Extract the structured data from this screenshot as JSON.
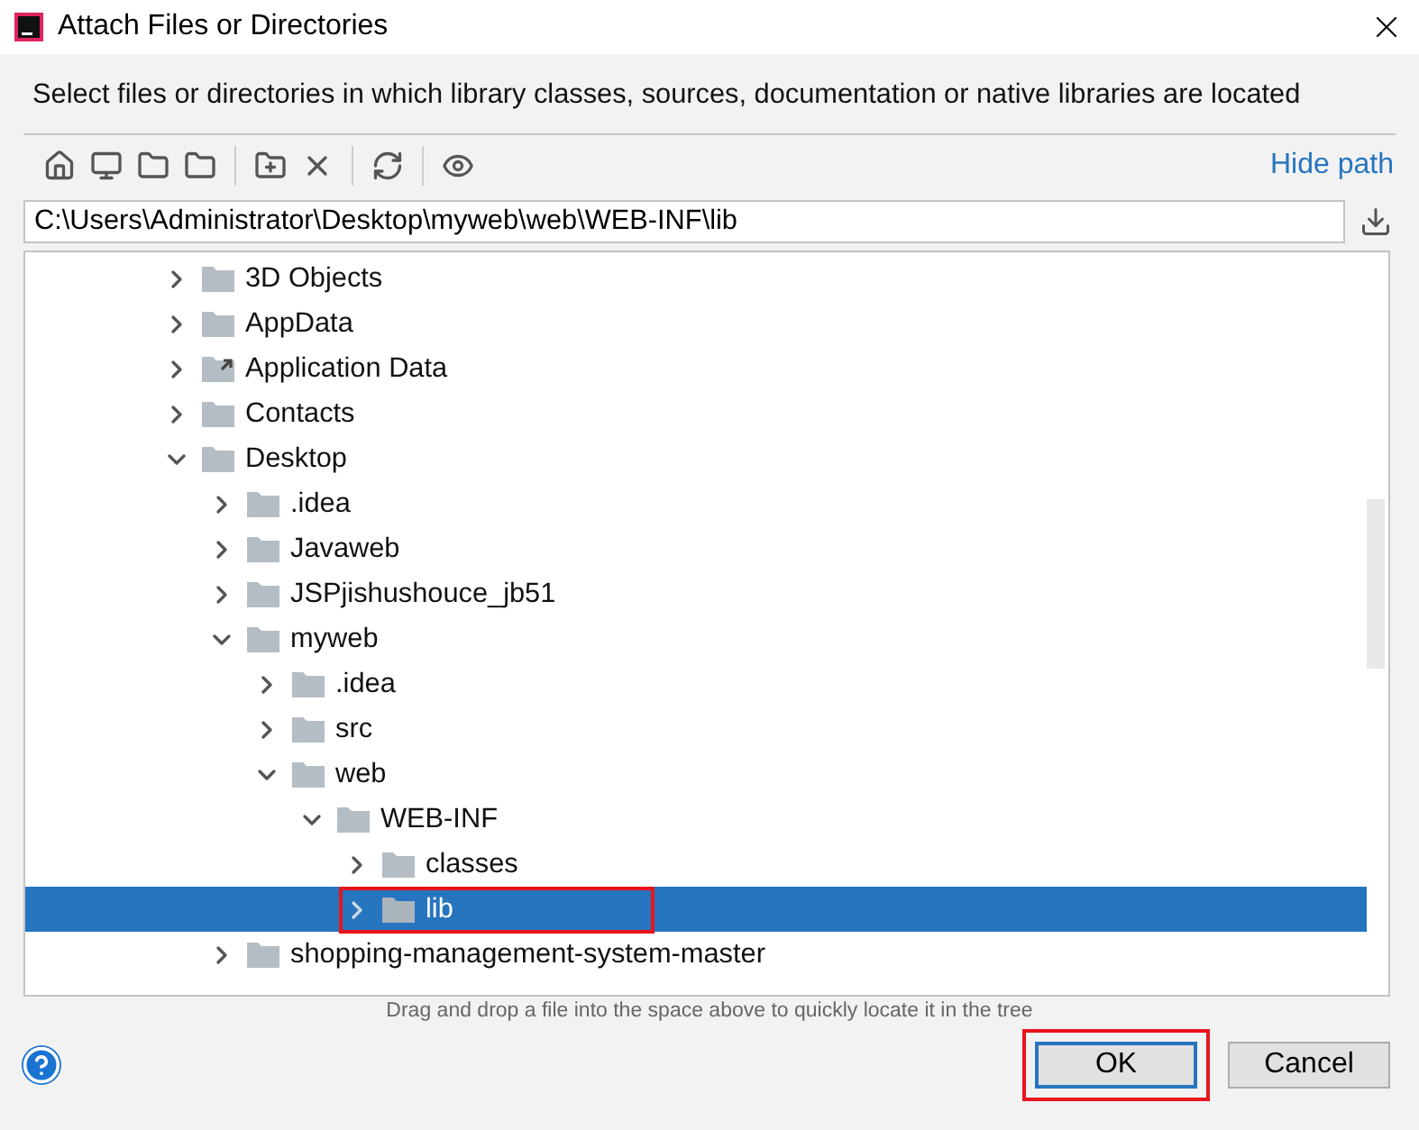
{
  "window": {
    "title": "Attach Files or Directories"
  },
  "description": "Select files or directories in which library classes, sources, documentation or native libraries are located",
  "toolbar": {
    "hide_path_link": "Hide path"
  },
  "path_field": {
    "value": "C:\\Users\\Administrator\\Desktop\\myweb\\web\\WEB-INF\\lib"
  },
  "tree": [
    {
      "label": "3D Objects",
      "kind": "folder",
      "expanded": false,
      "selected": false,
      "highlighted": false
    },
    {
      "label": "AppData",
      "kind": "folder",
      "expanded": false,
      "selected": false,
      "highlighted": false
    },
    {
      "label": "Application Data",
      "kind": "link",
      "expanded": false,
      "selected": false,
      "highlighted": false
    },
    {
      "label": "Contacts",
      "kind": "folder",
      "expanded": false,
      "selected": false,
      "highlighted": false
    },
    {
      "label": "Desktop",
      "kind": "folder",
      "expanded": true,
      "selected": false,
      "highlighted": false,
      "children": [
        {
          "label": ".idea",
          "kind": "folder",
          "expanded": false,
          "selected": false,
          "highlighted": false
        },
        {
          "label": "Javaweb",
          "kind": "folder",
          "expanded": false,
          "selected": false,
          "highlighted": false
        },
        {
          "label": "JSPjishushouce_jb51",
          "kind": "folder",
          "expanded": false,
          "selected": false,
          "highlighted": false
        },
        {
          "label": "myweb",
          "kind": "folder",
          "expanded": true,
          "selected": false,
          "highlighted": false,
          "children": [
            {
              "label": ".idea",
              "kind": "folder",
              "expanded": false,
              "selected": false,
              "highlighted": false
            },
            {
              "label": "src",
              "kind": "folder",
              "expanded": false,
              "selected": false,
              "highlighted": false
            },
            {
              "label": "web",
              "kind": "folder",
              "expanded": true,
              "selected": false,
              "highlighted": false,
              "children": [
                {
                  "label": "WEB-INF",
                  "kind": "folder",
                  "expanded": true,
                  "selected": false,
                  "highlighted": false,
                  "children": [
                    {
                      "label": "classes",
                      "kind": "folder",
                      "expanded": false,
                      "selected": false,
                      "highlighted": false
                    },
                    {
                      "label": "lib",
                      "kind": "folder",
                      "expanded": false,
                      "selected": true,
                      "highlighted": true
                    }
                  ]
                }
              ]
            }
          ]
        },
        {
          "label": "shopping-management-system-master",
          "kind": "folder",
          "expanded": false,
          "selected": false,
          "highlighted": false
        }
      ]
    }
  ],
  "hint": "Drag and drop a file into the space above to quickly locate it in the tree",
  "buttons": [
    {
      "label": "OK",
      "default": true,
      "highlighted": true
    },
    {
      "label": "Cancel",
      "default": false,
      "highlighted": false
    }
  ]
}
